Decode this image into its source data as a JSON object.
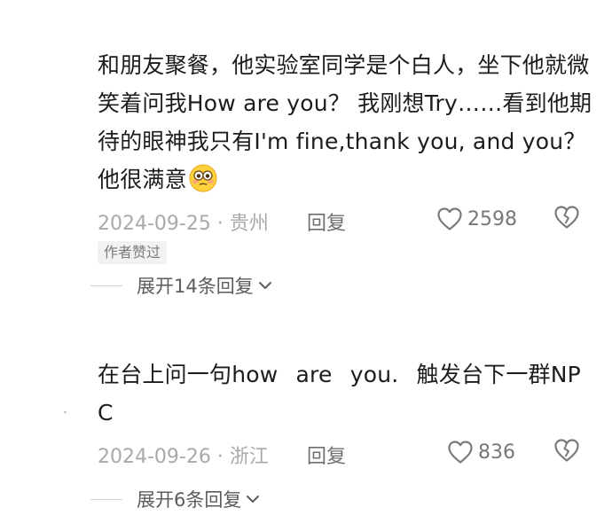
{
  "comments": [
    {
      "text": "和朋友聚餐，他实验室同学是个白人，坐下他就微笑着问我How are you？ 我刚想Try……看到他期待的眼神我只有I'm fine,thank you, and you？ 他很满意",
      "emoji": "flushed-face",
      "date_location": "2024-09-25 · 贵州",
      "reply_label": "回复",
      "likes": "2598",
      "author_badge": "作者赞过",
      "expand_label": "展开14条回复"
    },
    {
      "text": "在台上问一句how  are  you.   触发台下一群NPC",
      "date_location": "2024-09-26 · 浙江",
      "reply_label": "回复",
      "likes": "836",
      "expand_label": "展开6条回复"
    }
  ],
  "colors": {
    "text": "#1c1c1c",
    "meta": "#a9a9a9",
    "reply": "#6f6f6f",
    "icon": "#7a7a7a"
  }
}
